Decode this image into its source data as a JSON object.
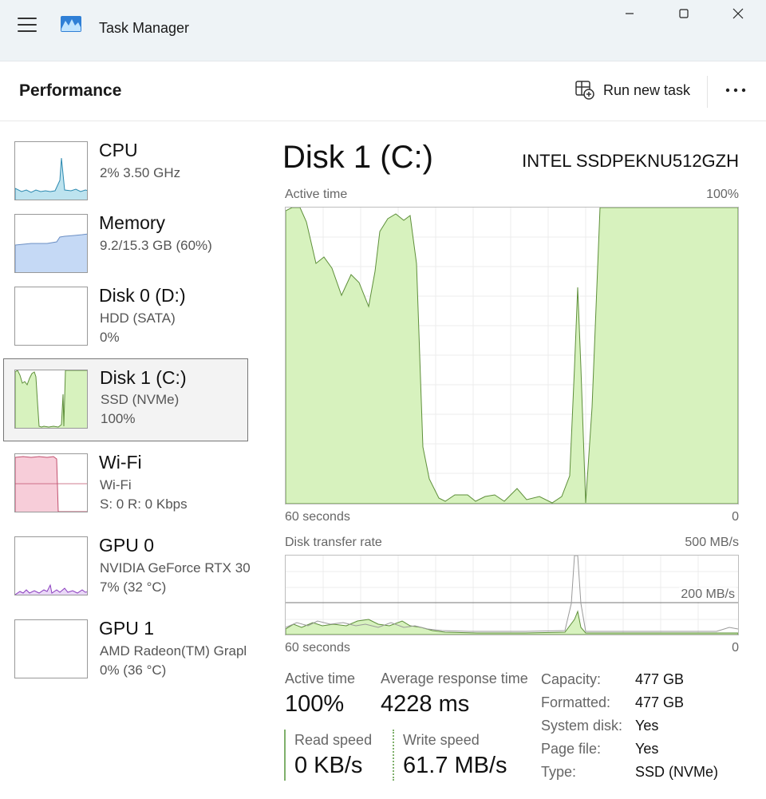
{
  "window": {
    "title": "Task Manager",
    "controls": [
      "minimize",
      "maximize",
      "close"
    ]
  },
  "header": {
    "page_title": "Performance",
    "run_new_task_label": "Run new task"
  },
  "sidebar": {
    "devices": [
      {
        "name": "CPU",
        "sub1": "2%  3.50 GHz",
        "sub2": ""
      },
      {
        "name": "Memory",
        "sub1": "9.2/15.3 GB (60%)",
        "sub2": ""
      },
      {
        "name": "Disk 0 (D:)",
        "sub1": "HDD (SATA)",
        "sub2": "0%"
      },
      {
        "name": "Disk 1 (C:)",
        "sub1": "SSD (NVMe)",
        "sub2": "100%",
        "selected": true
      },
      {
        "name": "Wi-Fi",
        "sub1": "Wi-Fi",
        "sub2": "S: 0  R: 0 Kbps"
      },
      {
        "name": "GPU 0",
        "sub1": "NVIDIA GeForce RTX 30",
        "sub2": "7%  (32 °C)"
      },
      {
        "name": "GPU 1",
        "sub1": "AMD Radeon(TM) Grapl",
        "sub2": "0%  (36 °C)"
      }
    ]
  },
  "main": {
    "title": "Disk 1 (C:)",
    "model": "INTEL SSDPEKNU512GZH",
    "active_time_graph": {
      "label": "Active time",
      "max_label": "100%",
      "time_label": "60 seconds",
      "min_label": "0"
    },
    "transfer_graph": {
      "label": "Disk transfer rate",
      "max_label": "500 MB/s",
      "ref_label": "200 MB/s",
      "time_label": "60 seconds",
      "min_label": "0"
    },
    "stats": {
      "active_time_label": "Active time",
      "active_time_value": "100%",
      "avg_response_label": "Average response time",
      "avg_response_value": "4228 ms",
      "read_label": "Read speed",
      "read_value": "0 KB/s",
      "write_label": "Write speed",
      "write_value": "61.7 MB/s"
    },
    "properties": [
      {
        "key": "Capacity:",
        "value": "477 GB"
      },
      {
        "key": "Formatted:",
        "value": "477 GB"
      },
      {
        "key": "System disk:",
        "value": "Yes"
      },
      {
        "key": "Page file:",
        "value": "Yes"
      },
      {
        "key": "Type:",
        "value": "SSD (NVMe)"
      }
    ]
  },
  "colors": {
    "disk_fill": "#d7f2be",
    "disk_line": "#5e8f3a",
    "cpu_fill": "#bde3ef",
    "cpu_line": "#2d8ab0",
    "memory_fill": "#c5d9f5",
    "memory_line": "#6b8fc4",
    "wifi_fill": "#f7cdd9",
    "wifi_line": "#c0506e",
    "gpu_line": "#8b3fbf",
    "accent_border": "#777777"
  }
}
